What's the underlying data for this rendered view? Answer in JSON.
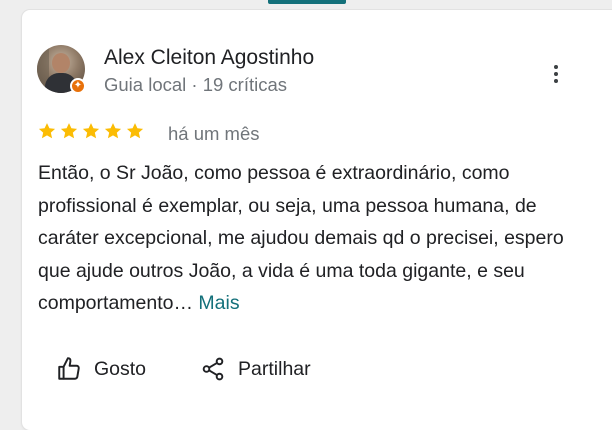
{
  "review": {
    "author_name": "Alex Cleiton Agostinho",
    "author_meta": "Guia local · 19 críticas",
    "rating": 5,
    "rating_max": 5,
    "date": "há um mês",
    "text": "Então, o Sr João, como pessoa é extraordinário, como profissional é exemplar, ou seja, uma pessoa humana, de caráter excepcional, me ajudou demais qd o precisei, espero que ajude outros João, a vida é uma toda gigante, e seu comportamento…",
    "more_label": "Mais"
  },
  "actions": {
    "like_label": "Gosto",
    "share_label": "Partilhar"
  },
  "icons": {
    "menu": "more-vert-icon",
    "like": "thumb-up-icon",
    "share": "share-icon",
    "badge": "local-guide-badge-icon",
    "star": "star-icon"
  },
  "colors": {
    "star": "#fbbc04",
    "link": "#13707a",
    "badge": "#e8710a",
    "accent_tab": "#13707a"
  }
}
